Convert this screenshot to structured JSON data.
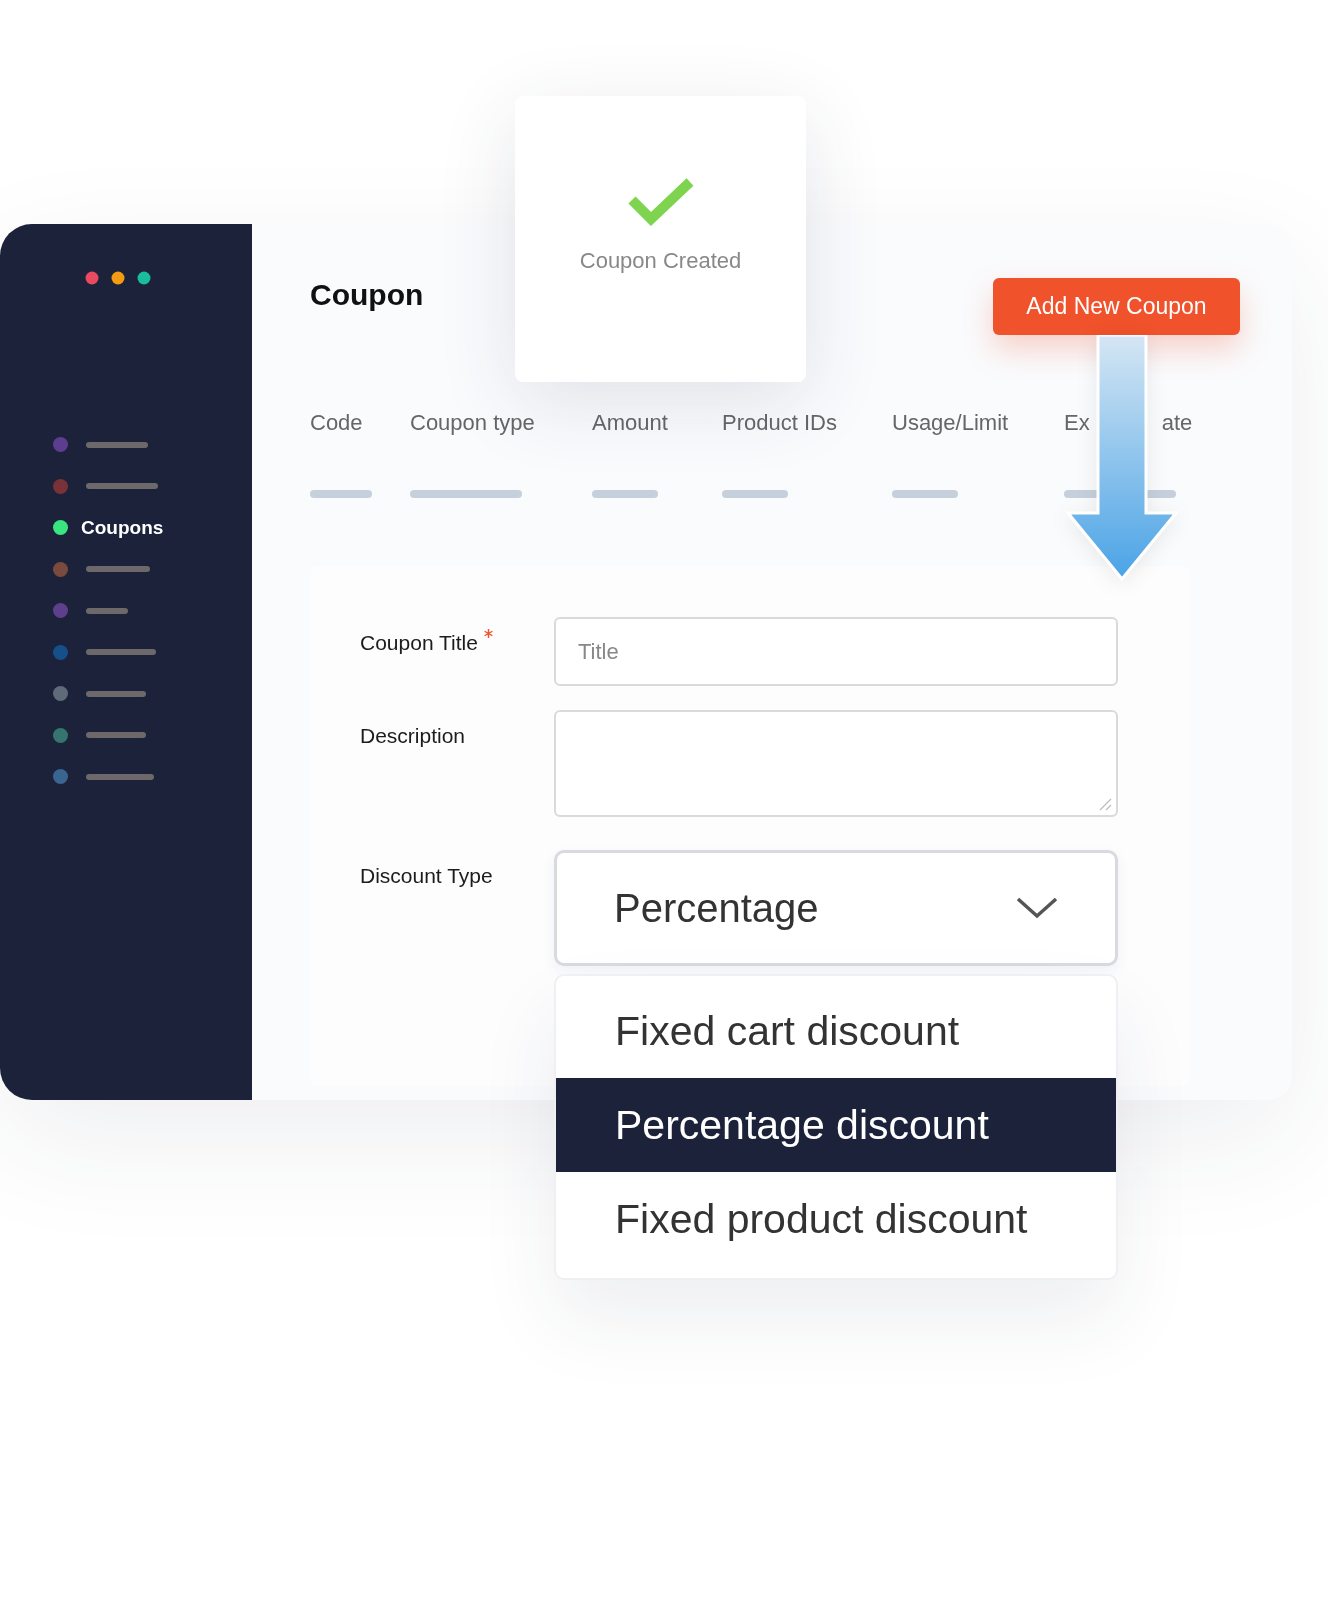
{
  "sidebar": {
    "items": [
      {
        "kind": "placeholder",
        "color": "#5c3d8f",
        "selected": false
      },
      {
        "kind": "placeholder",
        "color": "#7a3239",
        "selected": false
      },
      {
        "kind": "label",
        "label": "Coupons",
        "color": "#3ae57f",
        "selected": true
      },
      {
        "kind": "placeholder",
        "color": "#7a4a3e",
        "selected": false
      },
      {
        "kind": "placeholder",
        "color": "#5e3f8c",
        "selected": false
      },
      {
        "kind": "placeholder",
        "color": "#15508a",
        "selected": false
      },
      {
        "kind": "placeholder",
        "color": "#5f6b78",
        "selected": false
      },
      {
        "kind": "placeholder",
        "color": "#36746f",
        "selected": false
      },
      {
        "kind": "placeholder",
        "color": "#3a6590",
        "selected": false
      }
    ]
  },
  "page": {
    "title": "Coupon",
    "add_button": "Add New Coupon"
  },
  "toast": {
    "message": "Coupon Created"
  },
  "table": {
    "columns": [
      {
        "label": "Code"
      },
      {
        "label": "Coupon type"
      },
      {
        "label": "Amount"
      },
      {
        "label": "Product IDs"
      },
      {
        "label": "Usage/Limit"
      },
      {
        "label": "Ex",
        "label_after_arrow": "ate"
      }
    ]
  },
  "form": {
    "fields": [
      {
        "kind": "input",
        "label": "Coupon Title",
        "required": true,
        "placeholder": "Title"
      },
      {
        "kind": "textarea",
        "label": "Description",
        "required": false
      },
      {
        "kind": "select",
        "label": "Discount Type",
        "required": false,
        "value": "Percentage",
        "expanded": true,
        "options": [
          {
            "label": "Fixed cart discount",
            "selected": false
          },
          {
            "label": "Percentage discount",
            "selected": true
          },
          {
            "label": "Fixed product discount",
            "selected": false
          }
        ]
      }
    ]
  }
}
